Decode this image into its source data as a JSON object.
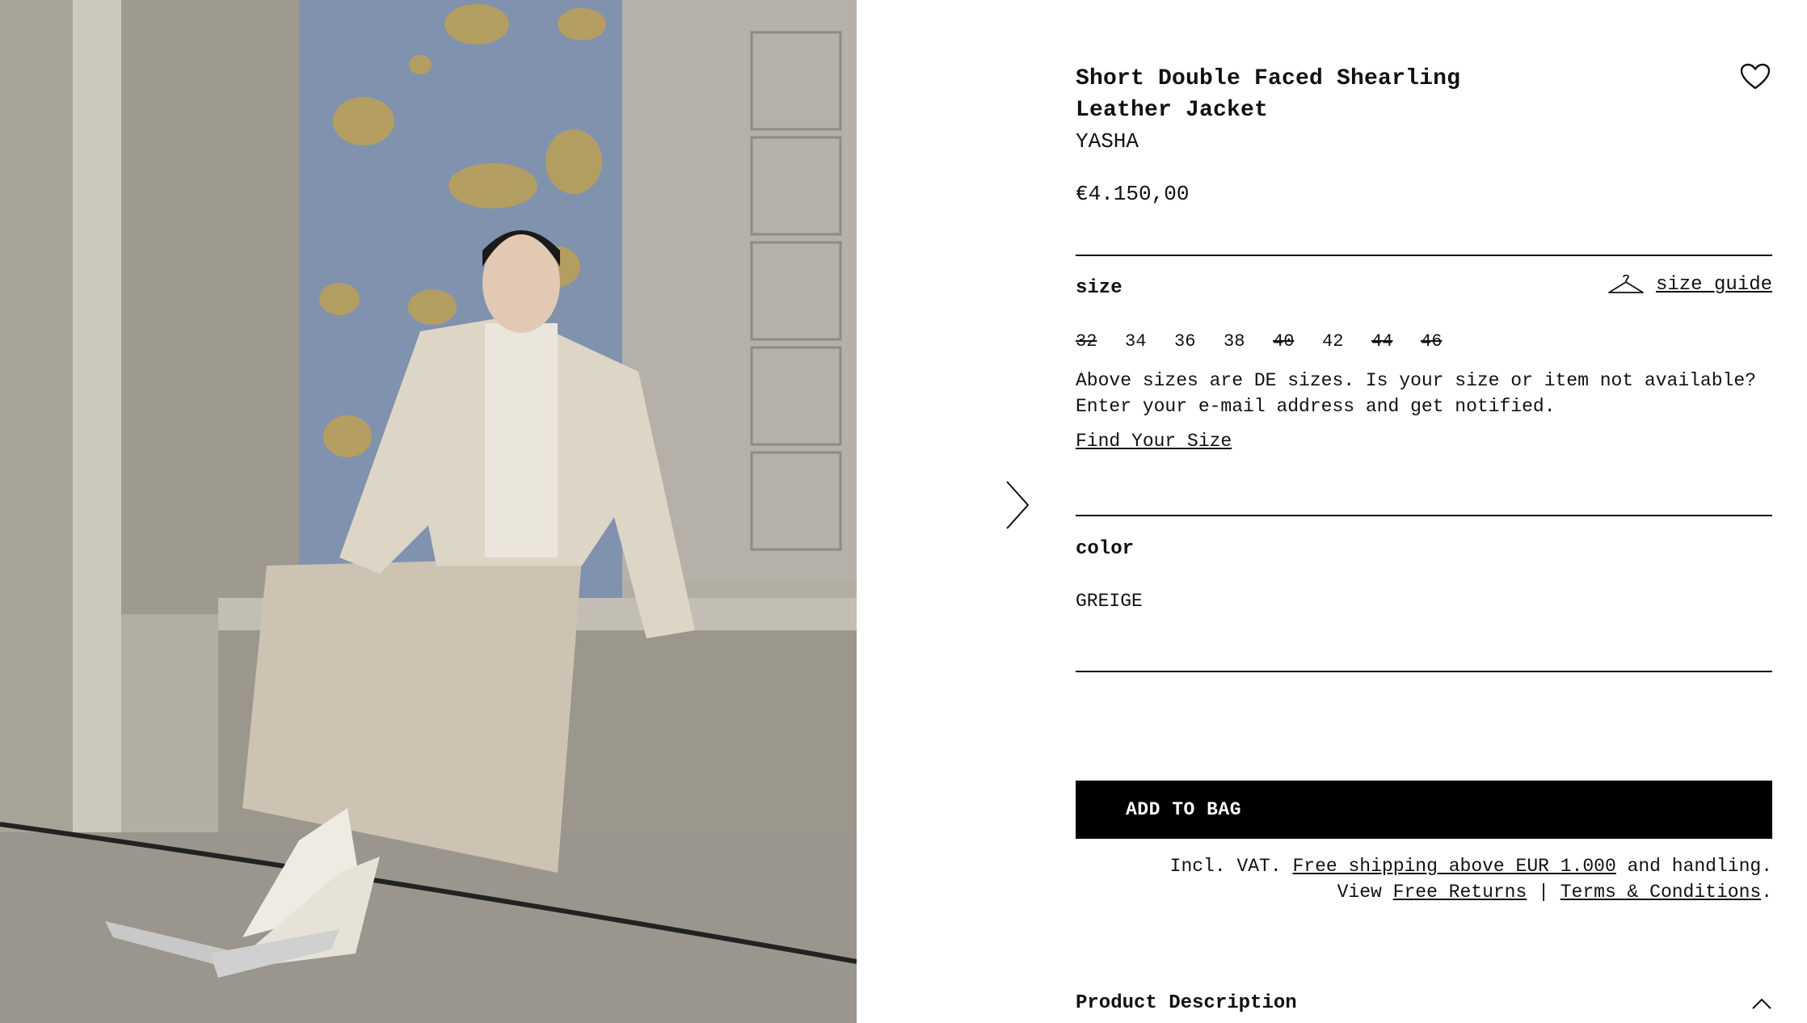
{
  "product": {
    "title": "Short Double Faced Shearling Leather Jacket",
    "brand": "YASHA",
    "price": "€4.150,00"
  },
  "icons": {
    "wishlist": "heart-icon",
    "size_guide": "hanger-icon",
    "next": "chevron-right-icon",
    "accordion": "chevron-up-icon"
  },
  "size": {
    "label": "size",
    "guide_label": "size guide",
    "options": [
      {
        "value": "32",
        "available": false
      },
      {
        "value": "34",
        "available": true
      },
      {
        "value": "36",
        "available": true
      },
      {
        "value": "38",
        "available": true
      },
      {
        "value": "40",
        "available": false
      },
      {
        "value": "42",
        "available": true
      },
      {
        "value": "44",
        "available": false
      },
      {
        "value": "46",
        "available": false
      }
    ],
    "note": "Above sizes are DE sizes. Is your size or item not available? Enter your e-mail address and get notified.",
    "find_size": "Find Your Size"
  },
  "color": {
    "label": "color",
    "value": "GREIGE"
  },
  "cart": {
    "add_label": "ADD TO BAG"
  },
  "shipping": {
    "prefix": "Incl. VAT.",
    "free_shipping": "Free shipping above EUR 1.000",
    "suffix": "and handling.",
    "view": "View",
    "free_returns": "Free Returns",
    "separator": "|",
    "terms": "Terms & Conditions",
    "end": "."
  },
  "description": {
    "label": "Product Description"
  },
  "colors": {
    "text": "#111111",
    "button_bg": "#000000",
    "button_text": "#ffffff",
    "background": "#ffffff"
  }
}
